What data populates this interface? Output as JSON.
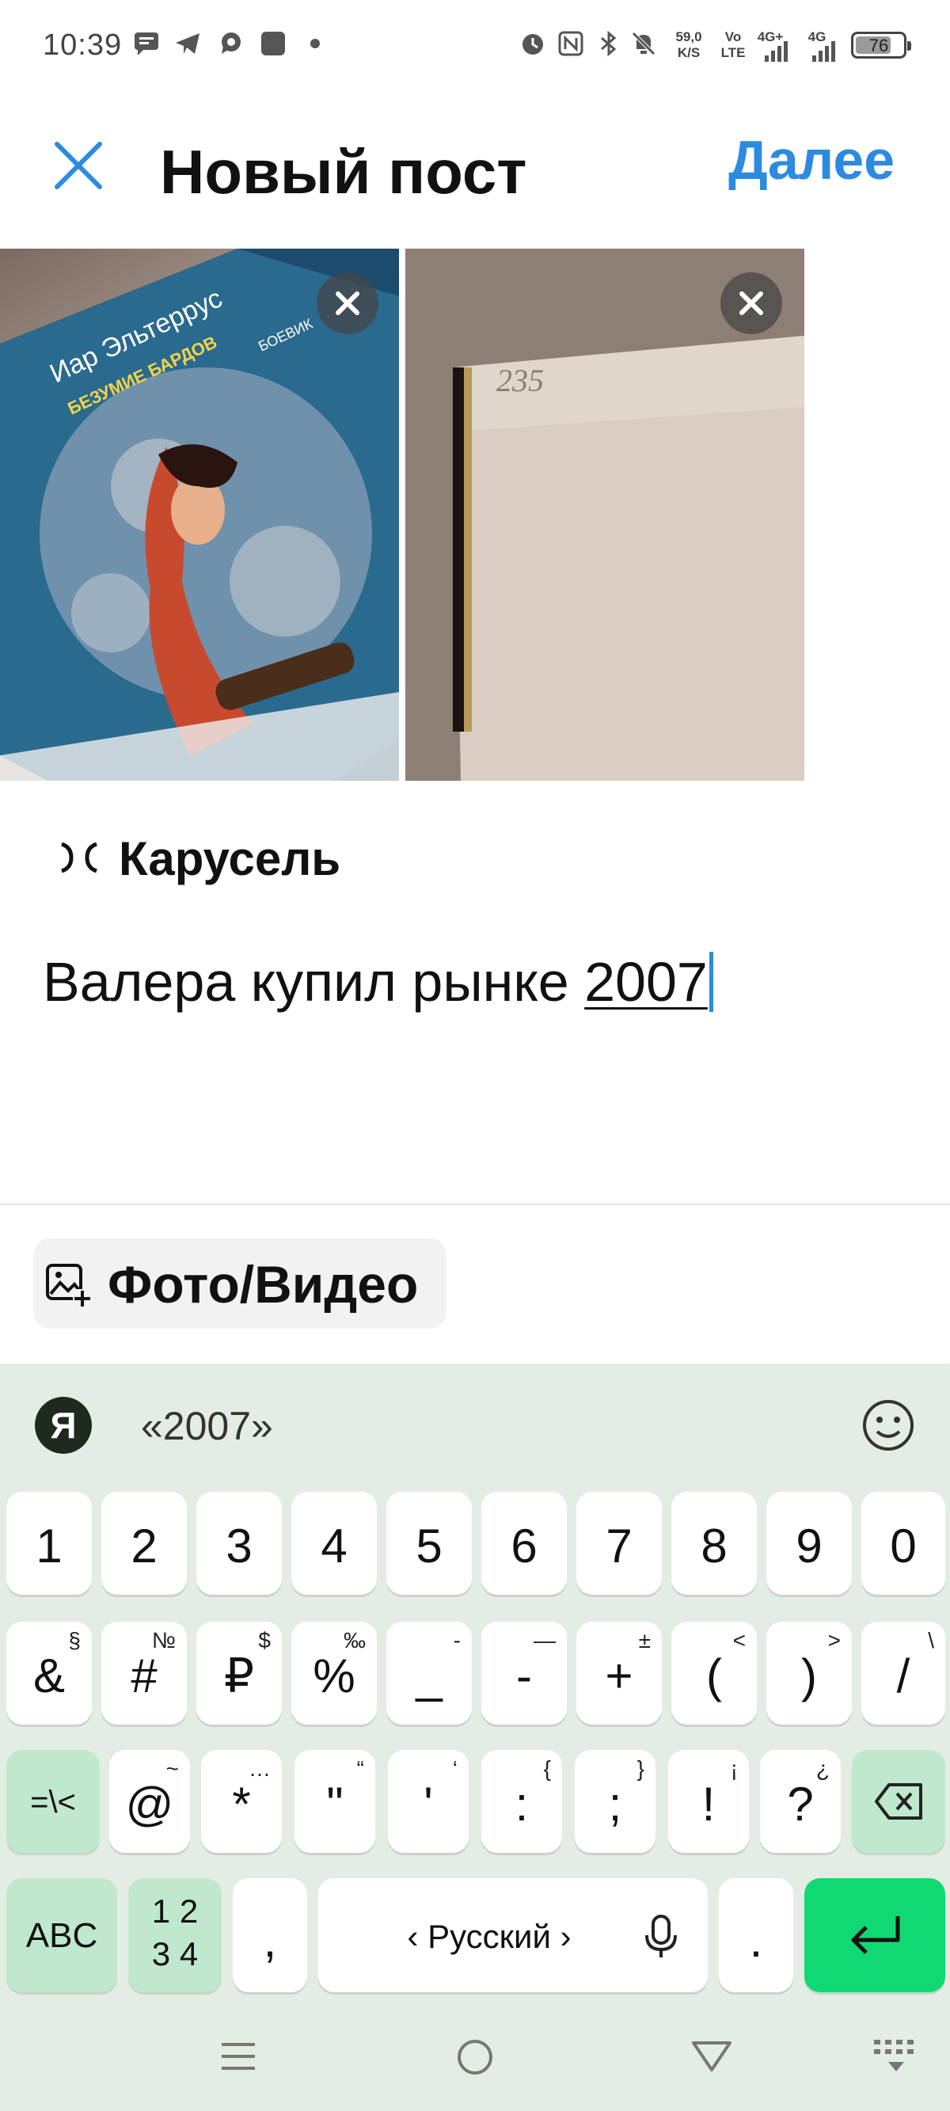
{
  "status_bar": {
    "time": "10:39",
    "speed_value": "59,0",
    "speed_unit": "K/S",
    "volte_top": "Vo",
    "volte_bottom": "LTE",
    "net1": "4G+",
    "net2": "4G",
    "battery": "76",
    "battery_level": 0.76,
    "left_icons": [
      "message-icon",
      "telegram-icon",
      "chat-bubble-icon",
      "app-square-icon",
      "dot-icon"
    ],
    "right_icons": [
      "alarm-icon",
      "nfc-icon",
      "bluetooth-icon",
      "mute-icon",
      "signal-icon",
      "battery-icon"
    ]
  },
  "header": {
    "title": "Новый пост",
    "next_label": "Далее",
    "close_icon": "close-icon"
  },
  "images": {
    "book_title_1": "Иар Эльтеррус",
    "book_title_2": "БЕЗУМИЕ БАРДОВ",
    "book_title_3": "БОЕВИК",
    "page_number": "235"
  },
  "carousel": {
    "label": "Карусель",
    "icon": "carousel-icon"
  },
  "caption": {
    "text": "Валера купил рынке ",
    "underlined": "2007"
  },
  "media_button": {
    "label": "Фото/Видео",
    "icon": "add-photo-icon"
  },
  "keyboard": {
    "logo": "Я",
    "suggestion": "«2007»",
    "row1": [
      "1",
      "2",
      "3",
      "4",
      "5",
      "6",
      "7",
      "8",
      "9",
      "0"
    ],
    "row2": [
      {
        "main": "&",
        "sup": "§"
      },
      {
        "main": "#",
        "sup": "№"
      },
      {
        "main": "₽",
        "sup": "$"
      },
      {
        "main": "%",
        "sup": "‰"
      },
      {
        "main": "_",
        "sup": "-"
      },
      {
        "main": "-",
        "sup": "—"
      },
      {
        "main": "+",
        "sup": "±"
      },
      {
        "main": "(",
        "sup": "<"
      },
      {
        "main": ")",
        "sup": ">"
      },
      {
        "main": "/",
        "sup": "\\"
      }
    ],
    "row3": [
      {
        "main": "@",
        "sup": "~"
      },
      {
        "main": "*",
        "sup": "…"
      },
      {
        "main": "\"",
        "sup": "“"
      },
      {
        "main": "'",
        "sup": "‘"
      },
      {
        "main": ":",
        "sup": "{"
      },
      {
        "main": ";",
        "sup": "}"
      },
      {
        "main": "!",
        "sup": "¡"
      },
      {
        "main": "?",
        "sup": "¿"
      }
    ],
    "symbols_toggle": "=\\<",
    "abc_label": "ABC",
    "num_label_top": "1 2",
    "num_label_bottom": "3 4",
    "comma": ",",
    "space_label": "‹ Русский ›",
    "period": ".",
    "colors": {
      "bg": "#e4ede4",
      "special_key": "#bfe8cf",
      "enter": "#10d973"
    }
  },
  "nav_bar": {
    "icons": [
      "menu-icon",
      "home-icon",
      "back-icon",
      "keyboard-switch-icon"
    ]
  },
  "colors": {
    "accent": "#2c8be0"
  }
}
